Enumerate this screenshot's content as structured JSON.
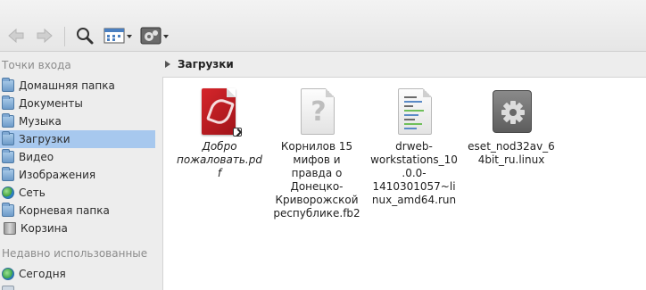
{
  "toolbar": {
    "back_icon": "arrow-left-icon",
    "forward_icon": "arrow-right-icon",
    "search_icon": "search-icon",
    "view_icon": "icon-view-icon",
    "settings_icon": "settings-icon"
  },
  "sidebar": {
    "places_header": "Точки входа",
    "places": [
      {
        "label": "Домашняя папка",
        "icon": "folder-icon"
      },
      {
        "label": "Документы",
        "icon": "folder-icon"
      },
      {
        "label": "Музыка",
        "icon": "folder-icon"
      },
      {
        "label": "Загрузки",
        "icon": "folder-icon",
        "selected": true
      },
      {
        "label": "Видео",
        "icon": "folder-icon"
      },
      {
        "label": "Изображения",
        "icon": "folder-icon"
      },
      {
        "label": "Сеть",
        "icon": "network-icon"
      },
      {
        "label": "Корневая папка",
        "icon": "folder-icon"
      },
      {
        "label": "Корзина",
        "icon": "trash-icon"
      }
    ],
    "recent_header": "Недавно использованные",
    "recent": [
      {
        "label": "Сегодня",
        "icon": "recent-icon"
      }
    ]
  },
  "path": {
    "current": "Загрузки"
  },
  "files": [
    {
      "name": "Добро пожаловать.pdf",
      "icon": "pdf-file-icon",
      "italic": true
    },
    {
      "name": "Корнилов 15 мифов и правда о Донецко-Криворожской республике.fb2",
      "icon": "unknown-file-icon"
    },
    {
      "name": "drweb-workstations_10.0.0-1410301057~linux_amd64.run",
      "icon": "script-file-icon"
    },
    {
      "name": "eset_nod32av_64bit_ru.linux",
      "icon": "executable-file-icon"
    }
  ],
  "colors": {
    "selection": "#a7c8ee",
    "sidebar_bg": "#ededed",
    "content_bg": "#ffffff"
  }
}
